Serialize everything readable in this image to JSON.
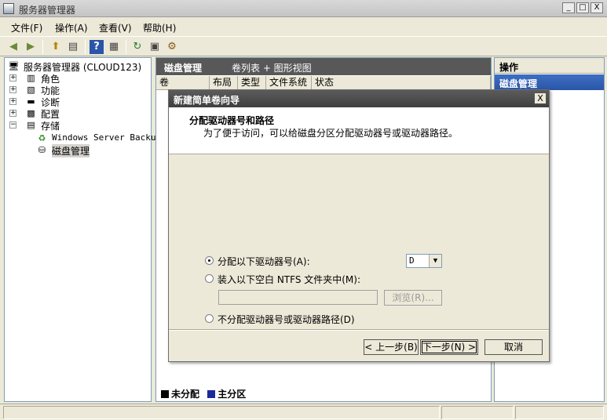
{
  "window": {
    "title": "服务器管理器",
    "controls": {
      "minimize": "_",
      "maximize": "□",
      "close": "X"
    }
  },
  "menu": {
    "items": [
      "文件(F)",
      "操作(A)",
      "查看(V)",
      "帮助(H)"
    ]
  },
  "toolbar": {
    "icons": [
      "back-icon",
      "forward-icon",
      "up-folder-icon",
      "show-hide-tree-icon",
      "help-icon",
      "properties-icon",
      "refresh-icon",
      "export-icon",
      "settings-icon"
    ]
  },
  "tree": {
    "root": "服务器管理器 (CLOUD123)",
    "items": [
      {
        "label": "角色",
        "expander": "+"
      },
      {
        "label": "功能",
        "expander": "+"
      },
      {
        "label": "诊断",
        "expander": "+"
      },
      {
        "label": "配置",
        "expander": "+"
      },
      {
        "label": "存储",
        "expander": "−"
      }
    ],
    "storage_children": [
      "Windows Server Backup",
      "磁盘管理"
    ]
  },
  "center": {
    "title": "磁盘管理",
    "view_label": "卷列表 + 图形视图",
    "columns": [
      "卷",
      "布局",
      "类型",
      "文件系统",
      "状态"
    ],
    "legend": [
      {
        "label": "未分配",
        "color": "#000000"
      },
      {
        "label": "主分区",
        "color": "#1a2a9c"
      }
    ]
  },
  "actions": {
    "header": "操作",
    "section": "磁盘管理"
  },
  "dialog": {
    "title": "新建简单卷向导",
    "close": "X",
    "header_title": "分配驱动器号和路径",
    "header_desc": "为了便于访问，可以给磁盘分区分配驱动器号或驱动器路径。",
    "options": {
      "assign_letter": "分配以下驱动器号(A):",
      "mount_folder": "装入以下空白 NTFS 文件夹中(M):",
      "no_assign": "不分配驱动器号或驱动器路径(D)"
    },
    "selected_option": "assign_letter",
    "drive_letter": "D",
    "folder_path": "",
    "browse": "浏览(R)...",
    "buttons": {
      "back": "< 上一步(B)",
      "next": "下一步(N) >",
      "cancel": "取消"
    }
  }
}
